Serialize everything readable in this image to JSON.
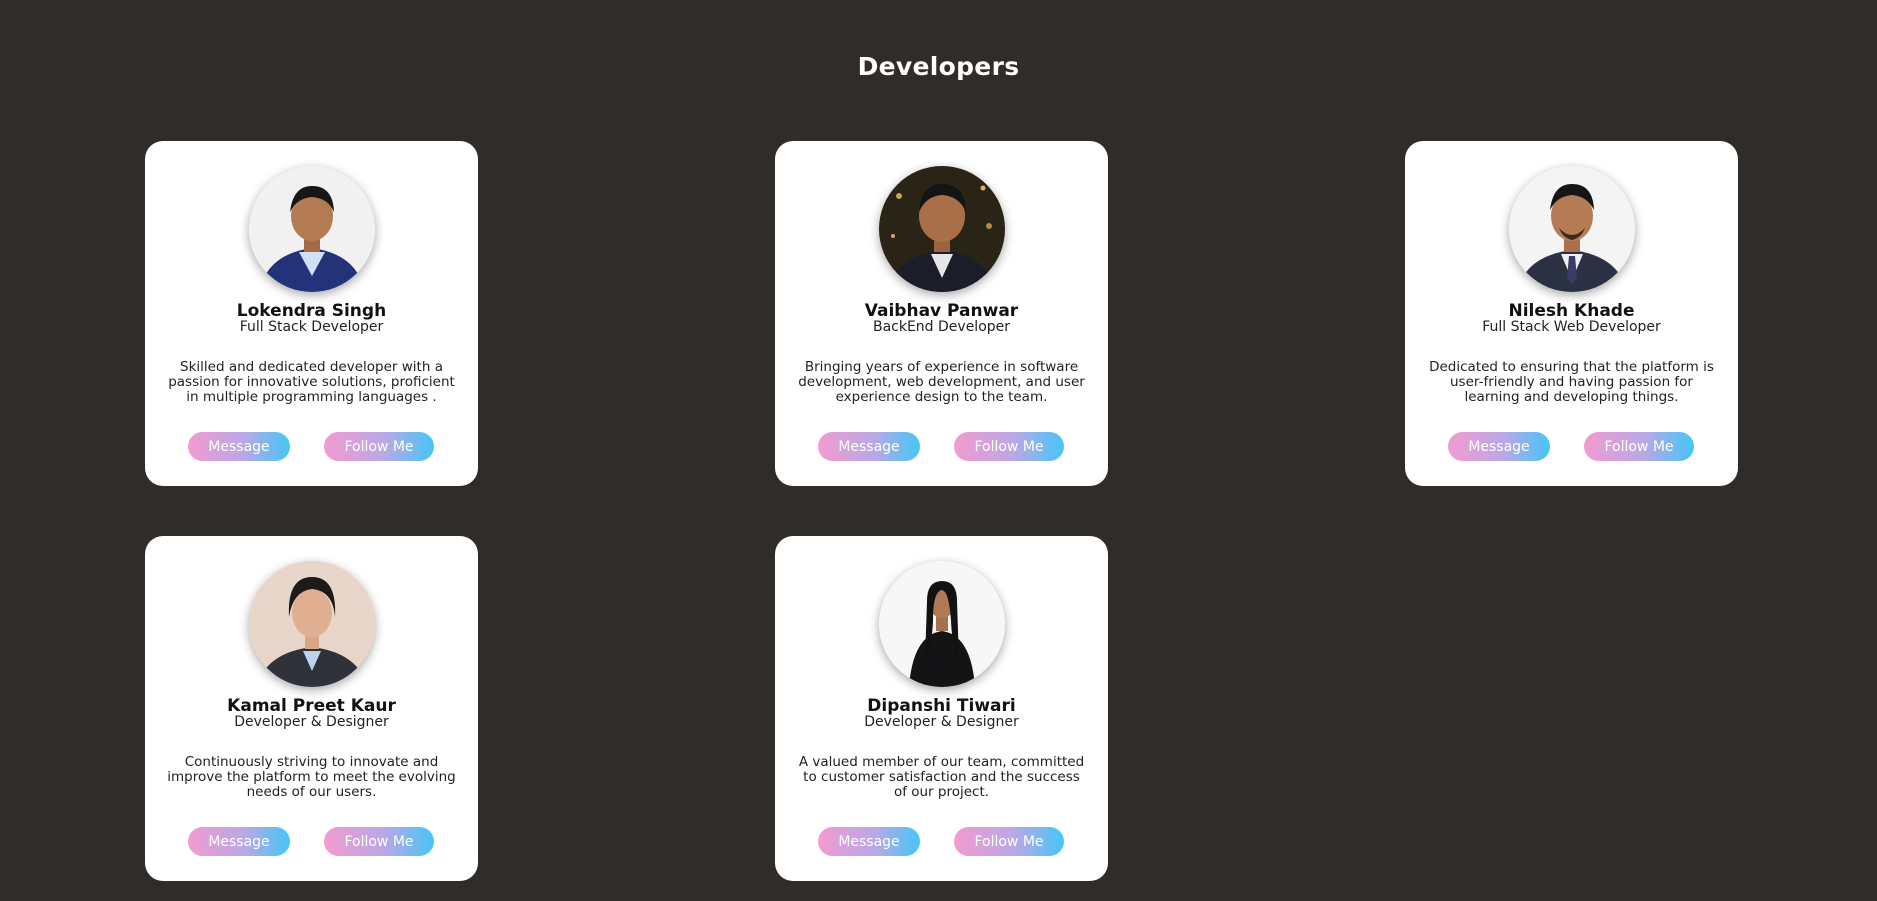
{
  "page": {
    "title": "Developers"
  },
  "buttons": {
    "message": "Message",
    "follow": "Follow Me"
  },
  "developers": [
    {
      "name": "Lokendra Singh",
      "role": "Full Stack Developer",
      "bio": "Skilled and dedicated developer with a passion for innovative solutions, proficient in multiple programming languages ."
    },
    {
      "name": "Vaibhav Panwar",
      "role": "BackEnd Developer",
      "bio": "Bringing years of experience in software development, web development, and user experience design to the team."
    },
    {
      "name": "Nilesh Khade",
      "role": "Full Stack Web Developer",
      "bio": "Dedicated to ensuring that the platform is user-friendly and having passion for learning and developing things."
    },
    {
      "name": "Kamal Preet Kaur",
      "role": "Developer & Designer",
      "bio": "Continuously striving to innovate and improve the platform to meet the evolving needs of our users."
    },
    {
      "name": "Dipanshi Tiwari",
      "role": "Developer & Designer",
      "bio": "A valued member of our team, committed to customer satisfaction and the success of our project."
    }
  ],
  "colors": {
    "background": "#302c29",
    "card": "#ffffff",
    "button_gradient_start": "#f29bd0",
    "button_gradient_end": "#45c6f6"
  }
}
